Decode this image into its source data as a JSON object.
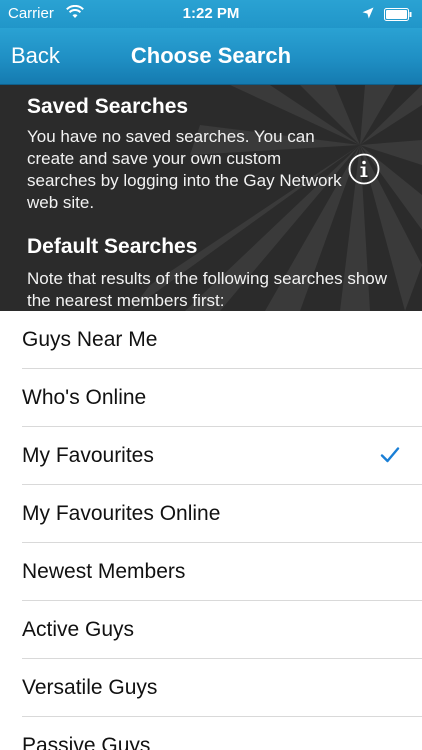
{
  "status_bar": {
    "carrier": "Carrier",
    "time": "1:22 PM"
  },
  "nav": {
    "back_label": "Back",
    "title": "Choose Search"
  },
  "info": {
    "saved_heading": "Saved Searches",
    "saved_text": "You have no saved searches. You can create and save your own custom searches by logging into the Gay Network web site.",
    "default_heading": "Default Searches",
    "default_text": "Note that results of the following searches show the nearest members first:"
  },
  "searches": [
    {
      "label": "Guys Near Me",
      "selected": false
    },
    {
      "label": "Who's Online",
      "selected": false
    },
    {
      "label": "My Favourites",
      "selected": true
    },
    {
      "label": "My Favourites Online",
      "selected": false
    },
    {
      "label": "Newest Members",
      "selected": false
    },
    {
      "label": "Active Guys",
      "selected": false
    },
    {
      "label": "Versatile Guys",
      "selected": false
    },
    {
      "label": "Passive Guys",
      "selected": false
    }
  ],
  "colors": {
    "accent": "#1a7fd6",
    "nav_top": "#2aa2d3",
    "nav_bottom": "#157bb0",
    "panel_bg": "#2b2b2b"
  }
}
